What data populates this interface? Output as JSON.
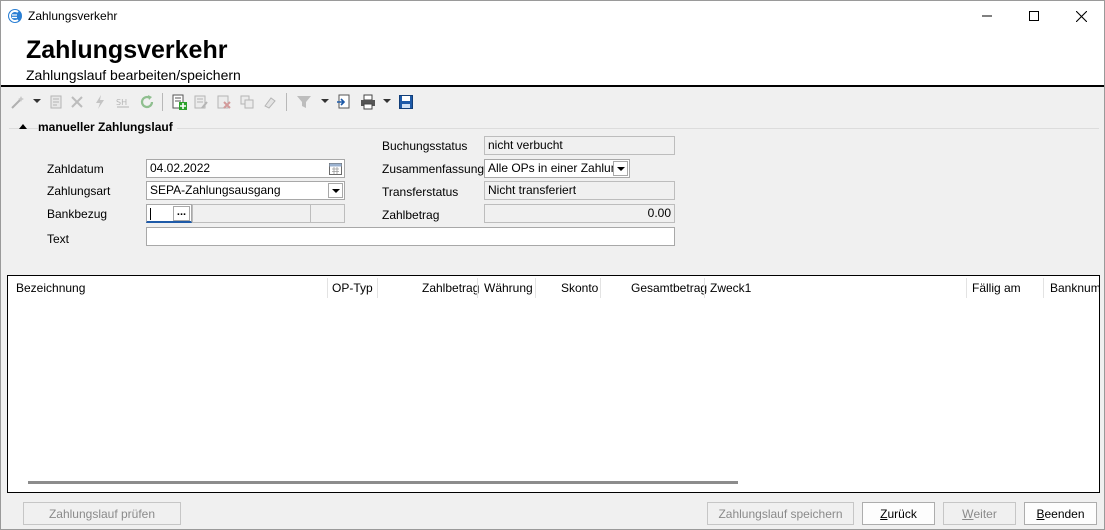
{
  "window": {
    "title": "Zahlungsverkehr"
  },
  "header": {
    "title": "Zahlungsverkehr",
    "subtitle": "Zahlungslauf bearbeiten/speichern"
  },
  "toolbar": {
    "icons": [
      "wand-icon",
      "document-icon",
      "delete-icon",
      "lightning-icon",
      "split-icon",
      "refresh-icon",
      "add-document-icon",
      "edit-document-icon",
      "delete-document-icon",
      "copy-document-icon",
      "eraser-icon",
      "filter-icon",
      "export-icon",
      "print-icon",
      "save-icon"
    ]
  },
  "group": {
    "title": "manueller Zahlungslauf"
  },
  "form": {
    "zahldatum_label": "Zahldatum",
    "zahldatum_value": "04.02.2022",
    "zahlungsart_label": "Zahlungsart",
    "zahlungsart_value": "SEPA-Zahlungsausgang",
    "bankbezug_label": "Bankbezug",
    "bankbezug_value": "",
    "bankbezug_button": "...",
    "text_label": "Text",
    "text_value": "",
    "buchungsstatus_label": "Buchungsstatus",
    "buchungsstatus_value": "nicht verbucht",
    "zusammenfassung_label": "Zusammenfassung",
    "zusammenfassung_value": "Alle OPs in einer Zahlung",
    "transferstatus_label": "Transferstatus",
    "transferstatus_value": "Nicht transferiert",
    "zahlbetrag_label": "Zahlbetrag",
    "zahlbetrag_value": "0.00"
  },
  "grid": {
    "columns": [
      "Bezeichnung",
      "OP-Typ",
      "Zahlbetrag",
      "Währung",
      "Skonto",
      "Gesamtbetrag",
      "Zweck1",
      "Fällig am",
      "Banknumm"
    ],
    "rows": []
  },
  "footer": {
    "pruefen": "Zahlungslauf prüfen",
    "speichern": "Zahlungslauf speichern",
    "zurueck_mn": "Z",
    "zurueck_rest": "urück",
    "weiter_mn": "W",
    "weiter_rest": "eiter",
    "beenden_mn": "B",
    "beenden_rest": "eenden"
  },
  "colors": {
    "accent": "#1e5aa8",
    "grid_border": "#000000",
    "disabled_text": "#8a8a8a"
  }
}
